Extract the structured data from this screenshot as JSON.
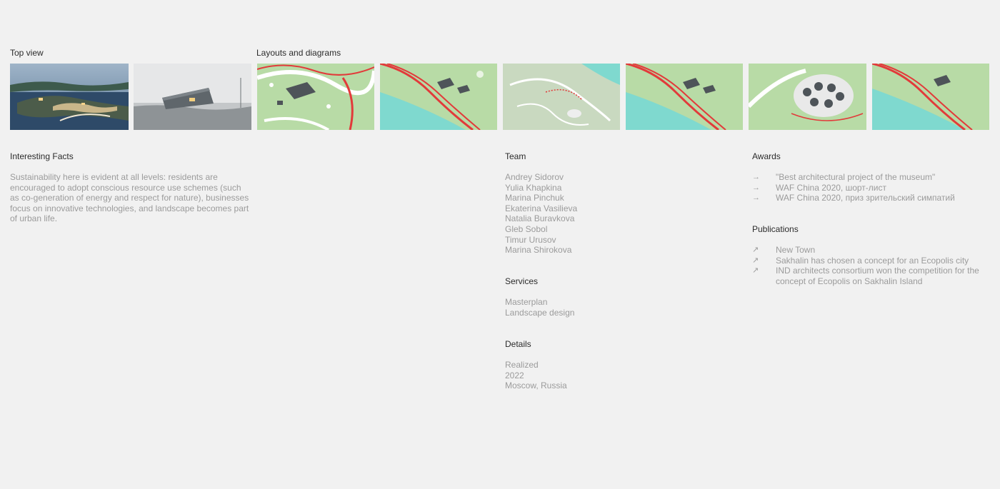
{
  "gallery": {
    "top_view_title": "Top view",
    "layouts_title": "Layouts and diagrams"
  },
  "facts": {
    "title": "Interesting Facts",
    "text": "Sustainability here is evident at all levels: residents are encouraged to adopt conscious resource use schemes (such as co-generation of energy and respect for nature), businesses focus on innovative technologies, and landscape becomes part of urban life."
  },
  "team": {
    "title": "Team",
    "members": [
      "Andrey Sidorov",
      "Yulia Khapkina",
      "Marina Pinchuk",
      "Ekaterina Vasilieva",
      "Natalia Buravkova",
      "Gleb Sobol",
      "Timur Urusov",
      "Marina Shirokova"
    ]
  },
  "services": {
    "title": "Services",
    "items": [
      "Masterplan",
      "Landscape design"
    ]
  },
  "details": {
    "title": "Details",
    "items": [
      "Realized",
      "2022",
      "Moscow, Russia"
    ]
  },
  "awards": {
    "title": "Awards",
    "items": [
      "\"Best architectural project of the museum\"",
      "WAF China 2020, шорт-лист",
      "WAF China 2020, приз зрительский симпатий"
    ]
  },
  "publications": {
    "title": "Publications",
    "items": [
      "New Town",
      "Sakhalin has chosen a concept for an Ecopolis city",
      "IND architects consortium won the competition for the concept of Ecopolis on Sakhalin Island"
    ]
  },
  "icons": {
    "award_arrow": "arrow-right-icon",
    "publication_arrow": "arrow-up-right-icon"
  },
  "colors": {
    "background": "#f1f1f1",
    "heading": "#2b2b2b",
    "muted": "#9b9b9b",
    "accent_red": "#e23a3a",
    "water": "#7fd9cf",
    "grass": "#b9dfa5"
  }
}
